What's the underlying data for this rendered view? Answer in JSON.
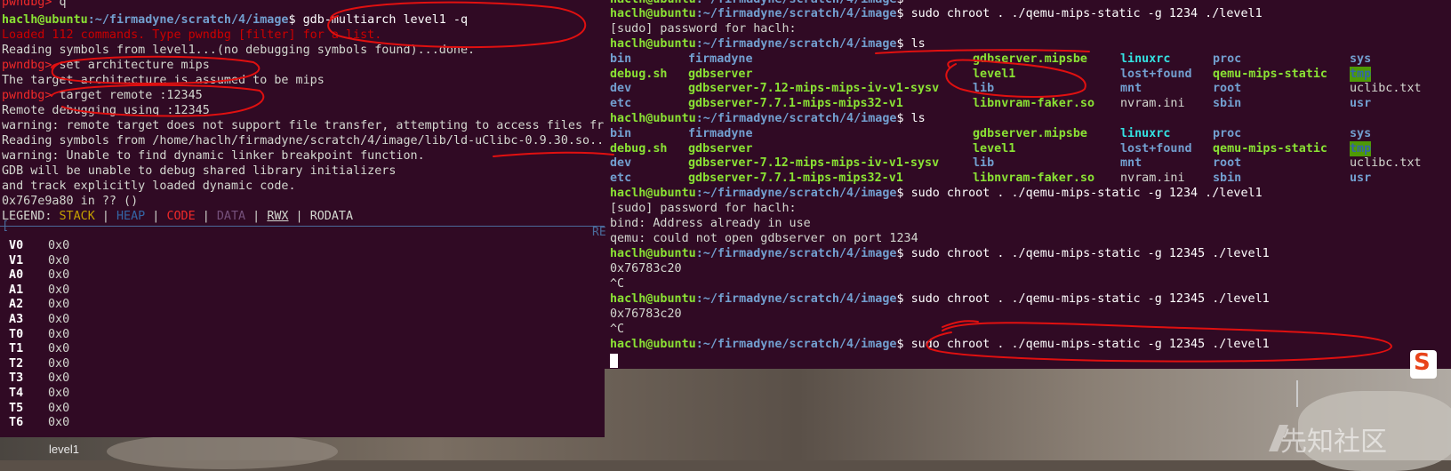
{
  "left_terminal": {
    "prompt_pwndbg": "pwndbg>",
    "cmd_q": " q",
    "user_host": "haclh@ubuntu",
    "path": ":~/firmadyne/scratch/4/image",
    "dollar": "$ ",
    "cmd_gdb": "gdb-multiarch level1 -q",
    "loaded_msg": "Loaded 112 commands. Type pwndbg [filter] for a list.",
    "reading_symbols": "Reading symbols from level1...(no debugging symbols found)...done.",
    "cmd_set_arch": " set architecture mips",
    "arch_msg": "The target architecture is assumed to be mips",
    "cmd_target": " target remote :12345",
    "remote_msg": "Remote debugging using :12345",
    "warn1": "warning: remote target does not support file transfer, attempting to access files from local filesystem.",
    "reading_lib": "Reading symbols from /home/haclh/firmadyne/scratch/4/image/lib/ld-uClibc-0.9.30.so...",
    "warn2": "warning: Unable to find dynamic linker breakpoint function.",
    "gdb_unable": "GDB will be unable to debug shared library initializers",
    "and_track": "and track explicitly loaded dynamic code.",
    "addr_line": "0x767e9a80 in ?? ()",
    "legend": {
      "label": "LEGEND: ",
      "stack": "STACK",
      "sep": " | ",
      "heap": "HEAP",
      "code": "CODE",
      "data": "DATA",
      "rwx": "RWX",
      "rodata": "RODATA"
    },
    "separator_start": "[",
    "separator_end": "RE",
    "registers": [
      {
        "name": "V0",
        "value": "0x0"
      },
      {
        "name": "V1",
        "value": "0x0"
      },
      {
        "name": "A0",
        "value": "0x0"
      },
      {
        "name": "A1",
        "value": "0x0"
      },
      {
        "name": "A2",
        "value": "0x0"
      },
      {
        "name": "A3",
        "value": "0x0"
      },
      {
        "name": "T0",
        "value": "0x0"
      },
      {
        "name": "T1",
        "value": "0x0"
      },
      {
        "name": "T2",
        "value": "0x0"
      },
      {
        "name": "T3",
        "value": "0x0"
      },
      {
        "name": "T4",
        "value": "0x0"
      },
      {
        "name": "T5",
        "value": "0x0"
      },
      {
        "name": "T6",
        "value": "0x0"
      }
    ]
  },
  "right_terminal": {
    "user_host": "haclh@ubuntu",
    "path": ":~/firmadyne/scratch/4/image",
    "dollar": "$ ",
    "cmd_chroot_1234": "sudo chroot . ./qemu-mips-static -g 1234 ./level1",
    "sudo_prompt": "[sudo] password for haclh:",
    "cmd_ls": "ls",
    "ls_columns": [
      [
        "bin",
        "debug.sh",
        "dev",
        "etc"
      ],
      [
        "firmadyne",
        "gdbserver",
        "gdbserver-7.12-mips-mips-iv-v1-sysv",
        "gdbserver-7.7.1-mips-mips32-v1"
      ],
      [
        "gdbserver.mipsbe",
        "level1",
        "lib",
        "libnvram-faker.so"
      ],
      [
        "linuxrc",
        "lost+found",
        "mnt",
        "nvram.ini"
      ],
      [
        "proc",
        "qemu-mips-static",
        "root",
        "sbin"
      ],
      [
        "sys",
        "tmp",
        "uclibc.txt",
        "usr"
      ]
    ],
    "bind_error": "bind: Address already in use",
    "qemu_error": "qemu: could not open gdbserver on port 1234",
    "cmd_chroot_12345": "sudo chroot . ./qemu-mips-static -g 12345 ./level1",
    "addr_out": "0x76783c20",
    "ctrl_c": "^C"
  },
  "taskbar": {
    "window_label": "level1"
  },
  "watermark": {
    "text": "先知社区"
  },
  "ime_icon": "sogou-ime-icon"
}
